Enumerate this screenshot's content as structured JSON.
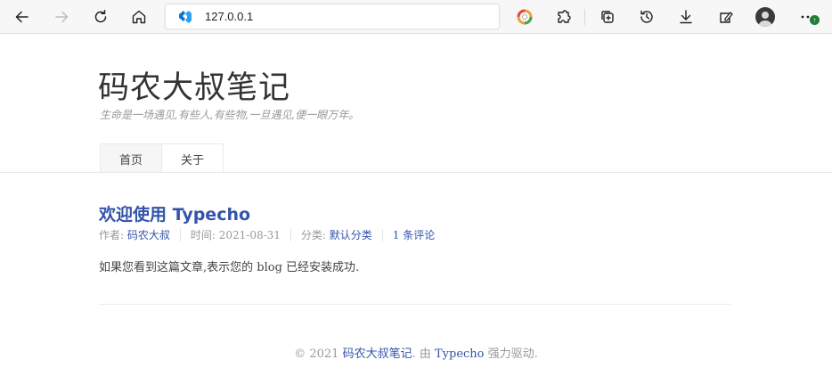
{
  "browser": {
    "url": "127.0.0.1",
    "update_badge": "↑",
    "icons": [
      "back-icon",
      "forward-icon",
      "refresh-icon",
      "home-icon",
      "site-icon",
      "color-extension-icon",
      "extensions-icon",
      "collections-icon",
      "history-icon",
      "download-icon",
      "screenshot-icon",
      "profile-avatar",
      "more-icon"
    ]
  },
  "site": {
    "title": "码农大叔笔记",
    "description": "生命是一场遇见,有些人,有些物,一旦遇见,便一眼万年。"
  },
  "nav": {
    "items": [
      {
        "label": "首页",
        "active": true
      },
      {
        "label": "关于",
        "active": false
      }
    ]
  },
  "post": {
    "title": "欢迎使用 Typecho",
    "author_label": "作者: ",
    "author": "码农大叔",
    "time_label": "时间: ",
    "time": "2021-08-31",
    "category_label": "分类: ",
    "category": "默认分类",
    "comments": "1 条评论",
    "body": "如果您看到这篇文章,表示您的 blog 已经安装成功."
  },
  "footer": {
    "copyright": "© 2021 ",
    "site_link": "码农大叔笔记",
    "by": ". 由 ",
    "engine": "Typecho",
    "powered": " 强力驱动."
  },
  "colors": {
    "link": "#3354AA",
    "muted": "#999999",
    "text": "#444444"
  }
}
